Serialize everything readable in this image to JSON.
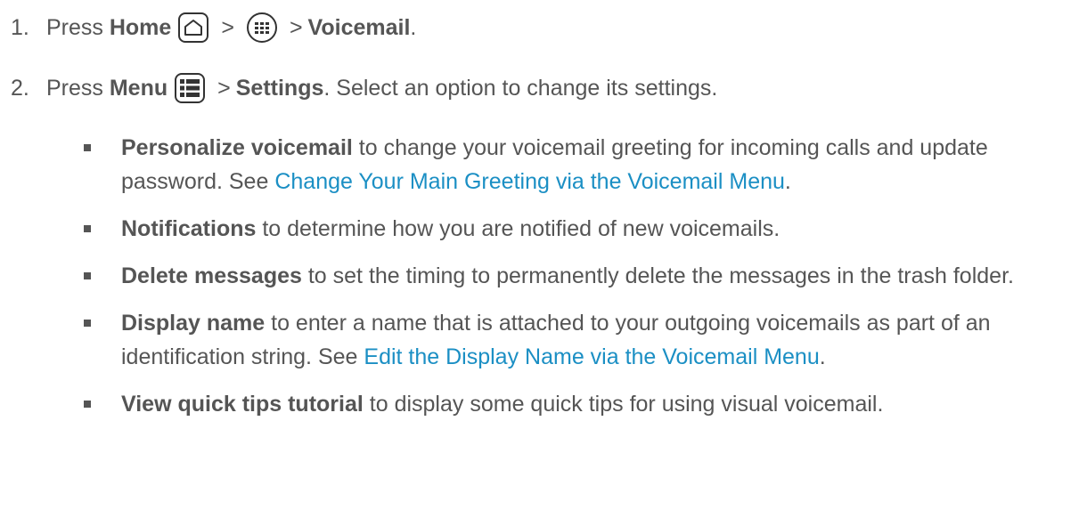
{
  "step1": {
    "number": "1.",
    "press": "Press",
    "home": "Home",
    "gt1": ">",
    "gt2": ">",
    "voicemail": "Voicemail",
    "period": "."
  },
  "step2": {
    "number": "2.",
    "press": "Press",
    "menu": "Menu",
    "gt": ">",
    "settings": "Settings",
    "rest": ". Select an option to change its settings."
  },
  "bullets": [
    {
      "term": "Personalize voicemail",
      "text": " to change your voicemail greeting for incoming calls and update password. See ",
      "link": "Change Your Main Greeting via the Voicemail Menu",
      "after": "."
    },
    {
      "term": "Notifications",
      "text": " to determine how you are notified of new voicemails.",
      "link": "",
      "after": ""
    },
    {
      "term": "Delete messages",
      "text": " to set the timing to permanently delete the messages in the trash folder.",
      "link": "",
      "after": ""
    },
    {
      "term": "Display name",
      "text": " to enter a name that is attached to your outgoing voicemails as part of an identification string. See ",
      "link": "Edit the Display Name via the Voicemail Menu",
      "after": "."
    },
    {
      "term": "View quick tips tutorial",
      "text": " to display some quick tips for using visual voicemail.",
      "link": "",
      "after": ""
    }
  ],
  "icons": {
    "home": "home-icon",
    "apps": "apps-icon",
    "menu": "menu-icon"
  },
  "colors": {
    "text": "#555555",
    "link": "#1b8fc4",
    "icon": "#333333"
  }
}
